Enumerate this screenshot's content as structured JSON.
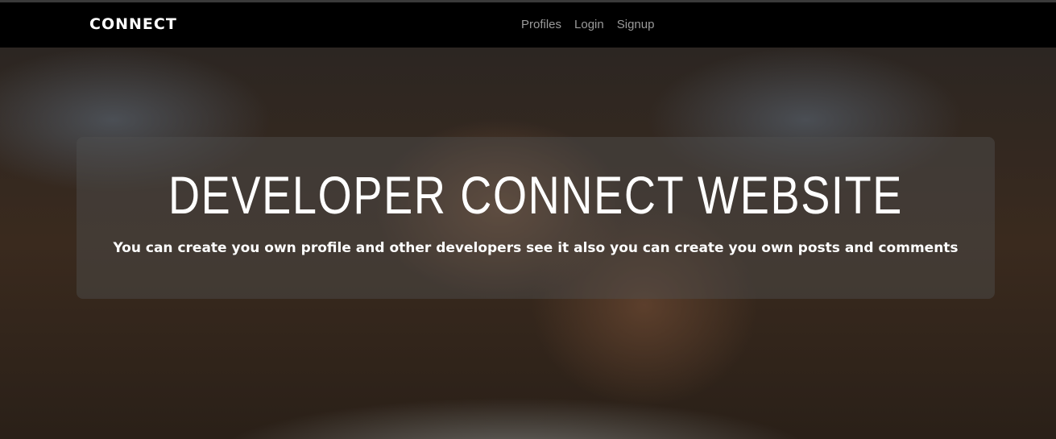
{
  "navbar": {
    "brand": "CONNECT",
    "links": [
      "Profiles",
      "Login",
      "Signup"
    ]
  },
  "hero": {
    "title": "DEVELOPER CONNECT WEBSITE",
    "subtitle": "You can create you own profile and other developers see it also you can create you own posts and comments"
  }
}
